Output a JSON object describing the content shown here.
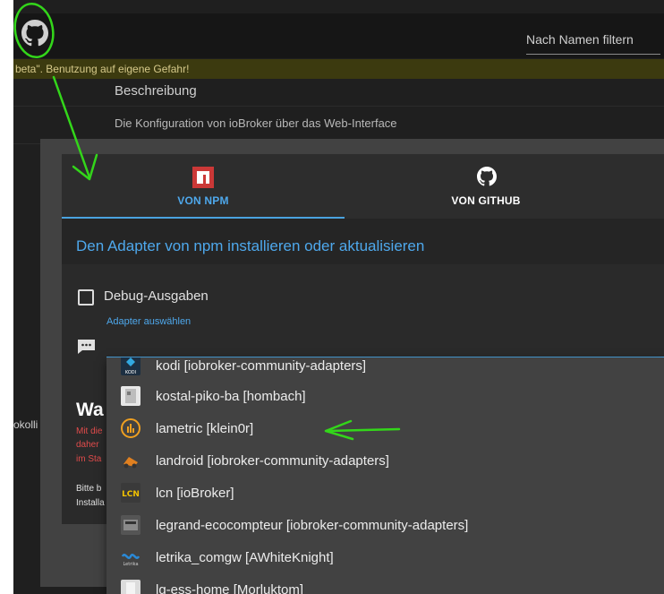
{
  "header": {
    "search_placeholder": "Nach Namen filtern"
  },
  "beta_banner": "beta\". Benutzung auf eigene Gefahr!",
  "background_table": {
    "column_header": "Beschreibung",
    "row_description": "Die Konfiguration von ioBroker über das Web-Interface",
    "left_fragment": "okolli"
  },
  "dialog": {
    "tabs": [
      {
        "label": "VON NPM",
        "icon": "npm-icon",
        "active": true
      },
      {
        "label": "VON GITHUB",
        "icon": "github-icon",
        "active": false
      }
    ],
    "title": "Den Adapter von npm installieren oder aktualisieren",
    "debug_label": "Debug-Ausgaben",
    "select_label": "Adapter auswählen",
    "warning": {
      "heading": "Wa",
      "red_lines": [
        "Mit die",
        "daher",
        "im Sta"
      ],
      "white_lines": [
        "Bitte b",
        "Installa"
      ]
    }
  },
  "dropdown": {
    "items": [
      {
        "text": "kodi [iobroker-community-adapters]",
        "icon": "kodi-icon",
        "icon_text": "KODI"
      },
      {
        "text": "kostal-piko-ba [hombach]",
        "icon": "kostal-icon",
        "icon_text": ""
      },
      {
        "text": "lametric [klein0r]",
        "icon": "lametric-icon",
        "icon_text": ""
      },
      {
        "text": "landroid [iobroker-community-adapters]",
        "icon": "landroid-icon",
        "icon_text": ""
      },
      {
        "text": "lcn [ioBroker]",
        "icon": "lcn-icon",
        "icon_text": "LCN"
      },
      {
        "text": "legrand-ecocompteur [iobroker-community-adapters]",
        "icon": "legrand-icon",
        "icon_text": ""
      },
      {
        "text": "letrika_comgw [AWhiteKnight]",
        "icon": "letrika-icon",
        "icon_text": "Letrika"
      },
      {
        "text": "lg-ess-home [Morluktom]",
        "icon": "lg-ess-icon",
        "icon_text": ""
      }
    ]
  },
  "colors": {
    "accent": "#4aa3df",
    "annotation": "#33d61a",
    "npm_red": "#cb3837",
    "warning_red": "#e04b4b"
  }
}
